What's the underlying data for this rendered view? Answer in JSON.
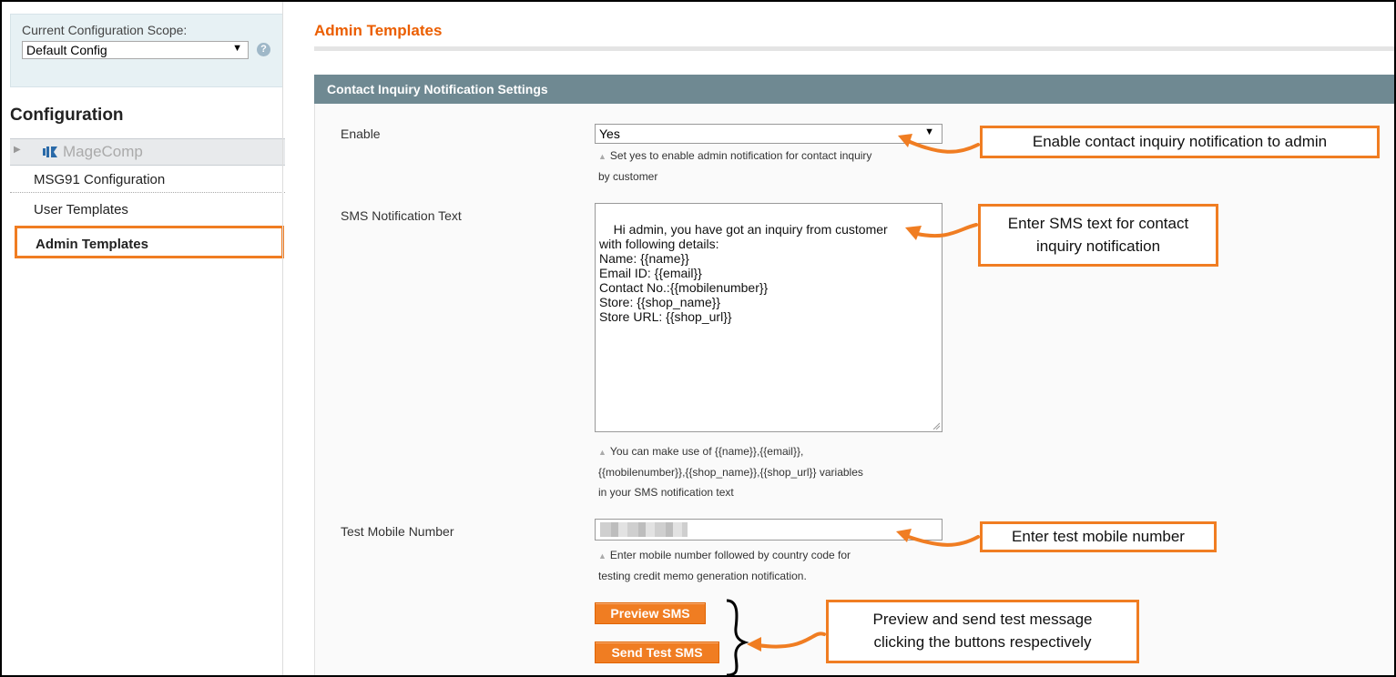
{
  "sidebar": {
    "scope_label": "Current Configuration Scope:",
    "scope_value": "Default Config",
    "config_heading": "Configuration",
    "brand": "MageComp",
    "items": [
      {
        "label": "MSG91 Configuration"
      },
      {
        "label": "User Templates"
      },
      {
        "label": "Admin Templates"
      }
    ]
  },
  "main": {
    "page_title": "Admin Templates",
    "section_title": "Contact Inquiry Notification Settings",
    "enable": {
      "label": "Enable",
      "value": "Yes",
      "note_line1": "Set yes to enable admin notification for contact inquiry",
      "note_line2": "by customer"
    },
    "sms": {
      "label": "SMS Notification Text",
      "value": "Hi admin, you have got an inquiry from customer\nwith following details:\nName: {{name}}\nEmail ID: {{email}}\nContact No.:{{mobilenumber}}\nStore: {{shop_name}}\nStore URL: {{shop_url}}",
      "note_line1": "You can make use of {{name}},{{email}},",
      "note_line2": "{{mobilenumber}},{{shop_name}},{{shop_url}} variables",
      "note_line3": "in your SMS notification text"
    },
    "test_mobile": {
      "label": "Test Mobile Number",
      "note_line1": "Enter mobile number followed by country code for",
      "note_line2": "testing credit memo generation notification."
    },
    "buttons": {
      "preview": "Preview SMS",
      "send": "Send Test SMS"
    }
  },
  "callouts": {
    "enable": "Enable contact inquiry notification to admin",
    "sms_line1": "Enter SMS text for contact",
    "sms_line2": "inquiry notification",
    "test": "Enter test mobile number",
    "preview_line1": "Preview and send test message",
    "preview_line2": "clicking the buttons respectively"
  },
  "colors": {
    "accent": "#f07d22",
    "title": "#eb5e00",
    "section_header": "#6f8992"
  }
}
